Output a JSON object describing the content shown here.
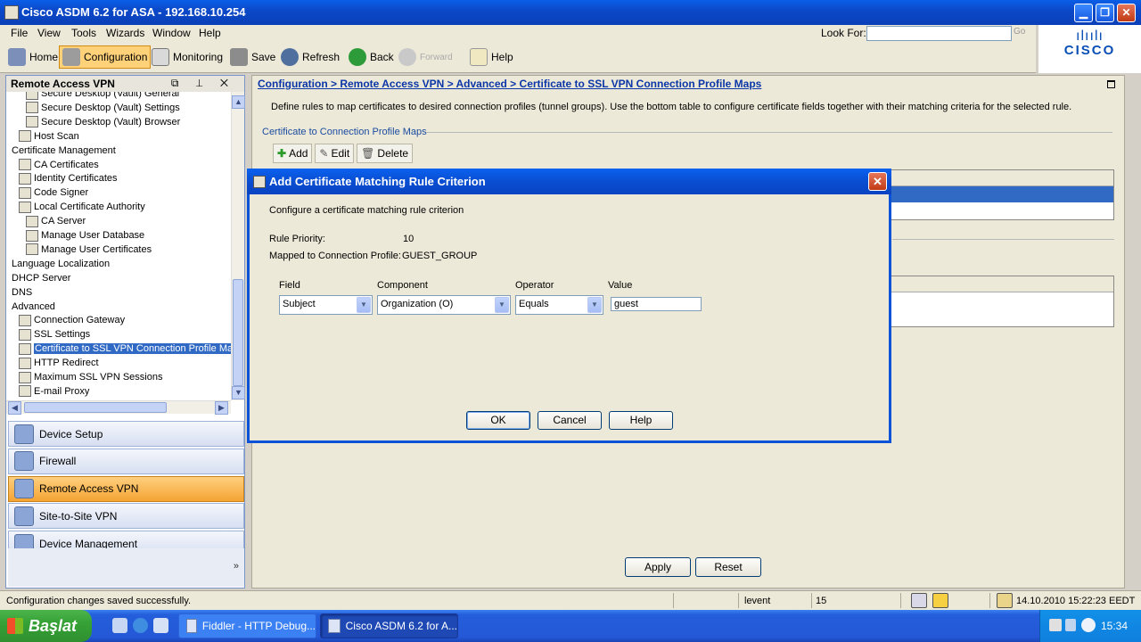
{
  "window": {
    "title": "Cisco ASDM 6.2 for ASA - 192.168.10.254",
    "minimize": "▁",
    "restore": "❐",
    "close": "✕"
  },
  "menu": {
    "items": [
      "File",
      "View",
      "Tools",
      "Wizards",
      "Window",
      "Help"
    ],
    "look_for_label": "Look For:",
    "look_for_value": "",
    "go_label": "Go"
  },
  "toolbar": {
    "home": "Home",
    "configuration": "Configuration",
    "monitoring": "Monitoring",
    "save": "Save",
    "refresh": "Refresh",
    "back": "Back",
    "forward": "Forward",
    "help": "Help"
  },
  "brand": {
    "bars": "ılıılı",
    "name": "CISCO"
  },
  "left_panel": {
    "title": "Remote Access VPN",
    "header_icons": "⧉ ⊥ ✕",
    "tree": [
      {
        "label": "Secure Desktop (Vault) General",
        "indent": 2
      },
      {
        "label": "Secure Desktop (Vault) Settings",
        "indent": 2
      },
      {
        "label": "Secure Desktop (Vault) Browser",
        "indent": 2
      },
      {
        "label": "Host Scan",
        "indent": 1
      },
      {
        "label": "Certificate Management",
        "indent": 0
      },
      {
        "label": "CA Certificates",
        "indent": 1
      },
      {
        "label": "Identity Certificates",
        "indent": 1
      },
      {
        "label": "Code Signer",
        "indent": 1
      },
      {
        "label": "Local Certificate Authority",
        "indent": 1
      },
      {
        "label": "CA Server",
        "indent": 2
      },
      {
        "label": "Manage User Database",
        "indent": 2
      },
      {
        "label": "Manage User Certificates",
        "indent": 2
      },
      {
        "label": "Language Localization",
        "indent": 0
      },
      {
        "label": "DHCP Server",
        "indent": 0
      },
      {
        "label": "DNS",
        "indent": 0
      },
      {
        "label": "Advanced",
        "indent": 0
      },
      {
        "label": "Connection Gateway",
        "indent": 1
      },
      {
        "label": "SSL Settings",
        "indent": 1
      },
      {
        "label": "Certificate to SSL VPN Connection Profile Maps",
        "indent": 1,
        "selected": true
      },
      {
        "label": "HTTP Redirect",
        "indent": 1
      },
      {
        "label": "Maximum SSL VPN Sessions",
        "indent": 1
      },
      {
        "label": "E-mail Proxy",
        "indent": 1
      }
    ],
    "nav": [
      {
        "label": "Device Setup"
      },
      {
        "label": "Firewall"
      },
      {
        "label": "Remote Access VPN",
        "active": true
      },
      {
        "label": "Site-to-Site VPN"
      },
      {
        "label": "Device Management"
      }
    ],
    "more": "»"
  },
  "main": {
    "breadcrumb": "Configuration > Remote Access VPN > Advanced > Certificate to SSL VPN Connection Profile Maps",
    "description": "Define rules to map certificates to desired connection profiles (tunnel groups). Use the bottom table to configure certificate fields together with their matching criteria for the selected rule.",
    "section_title": "Certificate to Connection Profile Maps",
    "add": "Add",
    "edit": "Edit",
    "delete": "Delete",
    "apply": "Apply",
    "reset": "Reset"
  },
  "dialog": {
    "title": "Add Certificate Matching Rule Criterion",
    "intro": "Configure a certificate matching rule criterion",
    "rule_priority_label": "Rule Priority:",
    "rule_priority_value": "10",
    "mapped_label": "Mapped to Connection Profile:",
    "mapped_value": "GUEST_GROUP",
    "field_label": "Field",
    "field_value": "Subject",
    "component_label": "Component",
    "component_value": "Organization (O)",
    "operator_label": "Operator",
    "operator_value": "Equals",
    "value_label": "Value",
    "value_value": "guest",
    "ok": "OK",
    "cancel": "Cancel",
    "help": "Help"
  },
  "statusbar": {
    "message": "Configuration changes saved successfully.",
    "user": "levent",
    "privilege": "15",
    "datetime": "14.10.2010 15:22:23 EEDT"
  },
  "taskbar": {
    "start": "Başlat",
    "tasks": [
      {
        "label": "Fiddler - HTTP Debug...",
        "active": false
      },
      {
        "label": "Cisco ASDM 6.2 for A...",
        "active": true
      }
    ],
    "clock": "15:34"
  },
  "colors": {
    "xp_blue": "#0a4ed1",
    "active_orange": "#f4a433",
    "selection": "#316ac5",
    "link": "#0b36a8"
  }
}
